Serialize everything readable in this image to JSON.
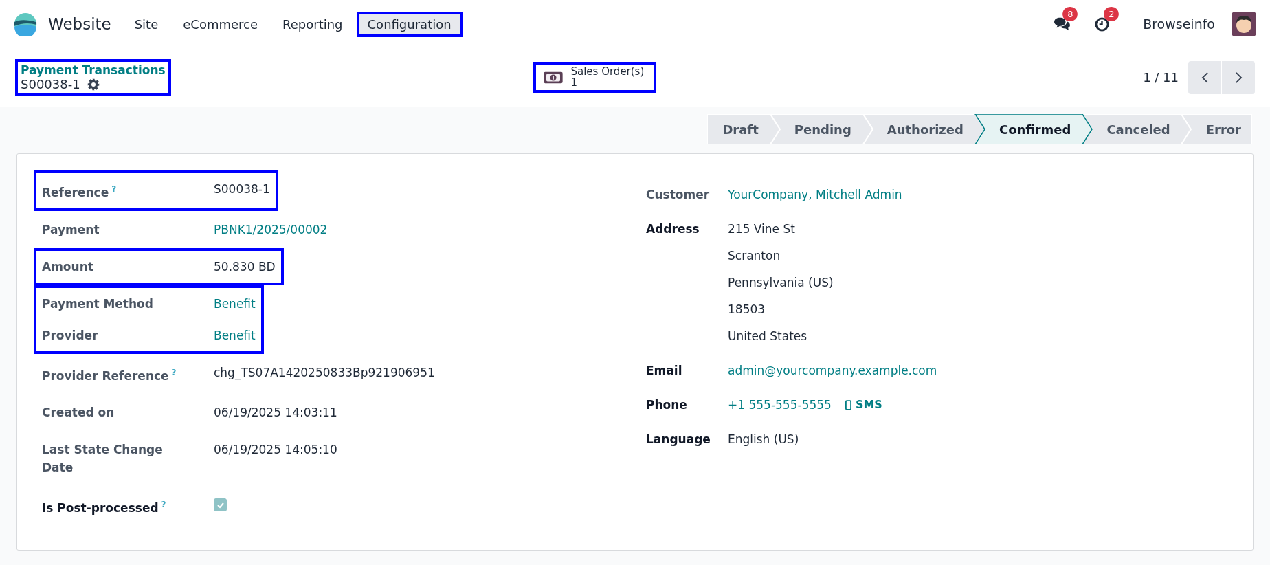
{
  "navbar": {
    "app": "Website",
    "menus": [
      {
        "label": "Site",
        "open": false,
        "highlighted": false
      },
      {
        "label": "eCommerce",
        "open": false,
        "highlighted": false
      },
      {
        "label": "Reporting",
        "open": false,
        "highlighted": false
      },
      {
        "label": "Configuration",
        "open": true,
        "highlighted": true
      }
    ],
    "messages_badge": "8",
    "activities_badge": "2",
    "user": "Browseinfo"
  },
  "control_panel": {
    "breadcrumb": {
      "parent": "Payment Transactions",
      "record": "S00038-1",
      "highlighted": true
    },
    "smart_button": {
      "label": "Sales Order(s)",
      "count": "1",
      "highlighted": true
    },
    "pager": "1 / 11"
  },
  "statusbar": [
    {
      "label": "Draft",
      "selected": false
    },
    {
      "label": "Pending",
      "selected": false
    },
    {
      "label": "Authorized",
      "selected": false
    },
    {
      "label": "Confirmed",
      "selected": true
    },
    {
      "label": "Canceled",
      "selected": false
    },
    {
      "label": "Error",
      "selected": false
    }
  ],
  "left_groups": [
    {
      "highlighted": true,
      "fields": [
        {
          "label": "Reference",
          "help": "?",
          "bold": false,
          "kind": "text",
          "value": "S00038-1"
        }
      ]
    },
    {
      "highlighted": false,
      "fields": [
        {
          "label": "Payment",
          "bold": false,
          "kind": "link",
          "value": "PBNK1/2025/00002"
        }
      ]
    },
    {
      "highlighted": true,
      "fields": [
        {
          "label": "Amount",
          "bold": false,
          "kind": "text",
          "value": "50.830 BD"
        }
      ]
    },
    {
      "highlighted": true,
      "fields": [
        {
          "label": "Payment Method",
          "bold": false,
          "kind": "link",
          "value": "Benefit"
        },
        {
          "label": "Provider",
          "bold": false,
          "kind": "link",
          "value": "Benefit"
        }
      ]
    },
    {
      "highlighted": false,
      "fields": [
        {
          "label": "Provider Reference",
          "help": "?",
          "bold": false,
          "kind": "text",
          "value": "chg_TS07A1420250833Bp921906951"
        }
      ]
    },
    {
      "highlighted": false,
      "fields": [
        {
          "label": "Created on",
          "bold": false,
          "kind": "text",
          "value": "06/19/2025 14:03:11"
        }
      ]
    },
    {
      "highlighted": false,
      "fields": [
        {
          "label": "Last State Change Date",
          "bold": false,
          "kind": "text",
          "value": "06/19/2025 14:05:10"
        }
      ]
    },
    {
      "highlighted": false,
      "fields": [
        {
          "label": "Is Post-processed",
          "help": "?",
          "bold": true,
          "kind": "checkbox",
          "checked": true
        }
      ]
    }
  ],
  "right_fields": [
    {
      "label": "Customer",
      "bold": false,
      "kind": "link",
      "value": "YourCompany, Mitchell Admin"
    },
    {
      "label": "Address",
      "bold": true,
      "kind": "address",
      "lines": [
        "215 Vine St",
        "Scranton",
        "Pennsylvania (US)",
        "18503",
        "United States"
      ]
    },
    {
      "label": "Email",
      "bold": true,
      "kind": "link",
      "value": "admin@yourcompany.example.com"
    },
    {
      "label": "Phone",
      "bold": true,
      "kind": "phone",
      "value": "+1 555-555-5555",
      "sms_button": "SMS"
    },
    {
      "label": "Language",
      "bold": true,
      "kind": "text",
      "value": "English (US)"
    }
  ]
}
